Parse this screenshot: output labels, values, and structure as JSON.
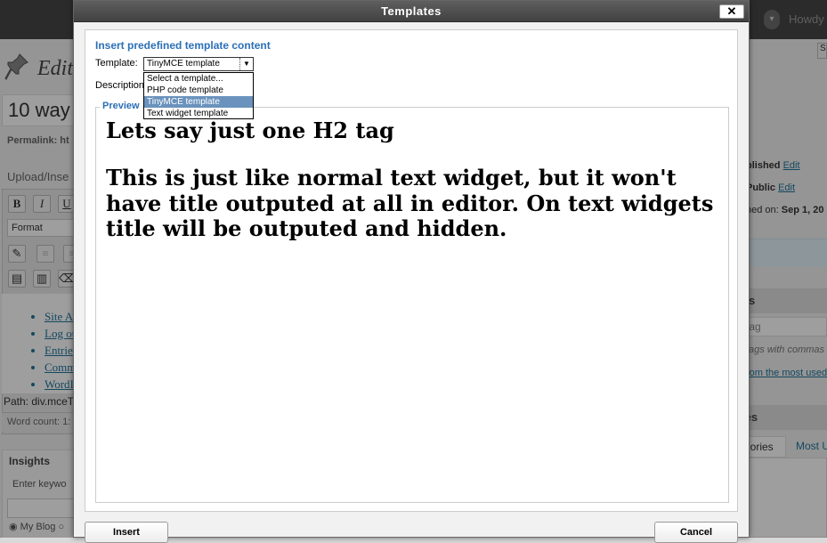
{
  "background": {
    "admin_bar": {
      "howdy": "Howdy",
      "search_glyph": "▾"
    },
    "page_title": "Edit",
    "post_title": "10 way",
    "permalink_label": "Permalink: ht",
    "upload_insert": "Upload/Inse",
    "toolbar": {
      "bold": "B",
      "italic": "I",
      "underline": "U",
      "format": "Format"
    },
    "editor_links": [
      "Site A",
      "Log ou",
      "Entrie",
      "Comm",
      "WordI"
    ],
    "path": "Path: div.mceT",
    "word_count": "Word count: 1:",
    "insights": {
      "title": "Insights",
      "keywords": "Enter keywo",
      "radio_label": "My Blog"
    },
    "sidebar": {
      "save": "S",
      "published": {
        "label": "blished",
        "link": "Edit"
      },
      "visibility": {
        "label": "Public",
        "link": "Edit"
      },
      "published_on": {
        "label": "hed on:",
        "value": "Sep 1, 20"
      },
      "tags_header": "gs",
      "tag_placeholder": "tag",
      "tag_hint": "tags with commas",
      "tag_link": "rom the most used",
      "categories_header": "ies",
      "cat_tab_all": "gories",
      "cat_tab_most": "Most U"
    }
  },
  "dialog": {
    "title": "Templates",
    "close_glyph": "✕",
    "legend": "Insert predefined template content",
    "template_label": "Template:",
    "template_selected": "TinyMCE template",
    "select_arrow": "▼",
    "description_label": "Description",
    "dropdown_options": [
      "Select a template...",
      "PHP code template",
      "TinyMCE template",
      "Text widget template"
    ],
    "dropdown_selected_index": 2,
    "preview_label": "Preview",
    "preview_heading": "Lets say just one H2 tag",
    "preview_paragraph": "This is just like normal text widget, but it won't have title outputed at all in editor. On text widgets title will be outputed and hidden.",
    "insert_button": "Insert",
    "cancel_button": "Cancel"
  },
  "colors": {
    "accent": "#2b6fb6",
    "dropdown_highlight": "#6a92bd",
    "titlebar": "#464646",
    "link": "#21759b"
  }
}
